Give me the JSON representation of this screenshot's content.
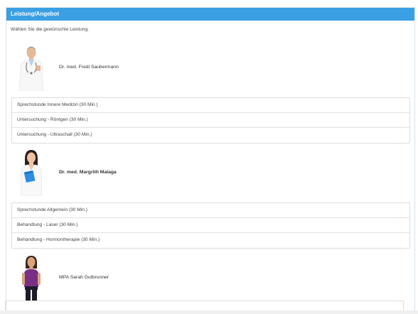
{
  "panel": {
    "title": "Leistung/Angebot",
    "instruction": "Wählen Sie die gewünschte Leistung."
  },
  "providers": [
    {
      "name": "Dr. med. Fredi Saubermann",
      "avatar_icon": "doctor-male-avatar-icon",
      "services": [
        "Sprechstunde Innere Medizin (30 Min.)",
        "Untersuchung - Röntgen (30 Min.)",
        "Untersuchung - Ultraschall (30 Min.)"
      ]
    },
    {
      "name": "Dr. med. Margrith Malaga",
      "avatar_icon": "doctor-female-avatar-icon",
      "services": [
        "Sprechstunde Allgemein (30 Min.)",
        "Behandlung - Laser (30 Min.)",
        "Behandlung - Hormontherapie (30 Min.)"
      ]
    },
    {
      "name": "MPA Sarah Gutbrunner",
      "avatar_icon": "assistant-female-avatar-icon",
      "services": []
    }
  ],
  "colors": {
    "header": "#3aa0e3",
    "border": "#dcdcdc"
  }
}
